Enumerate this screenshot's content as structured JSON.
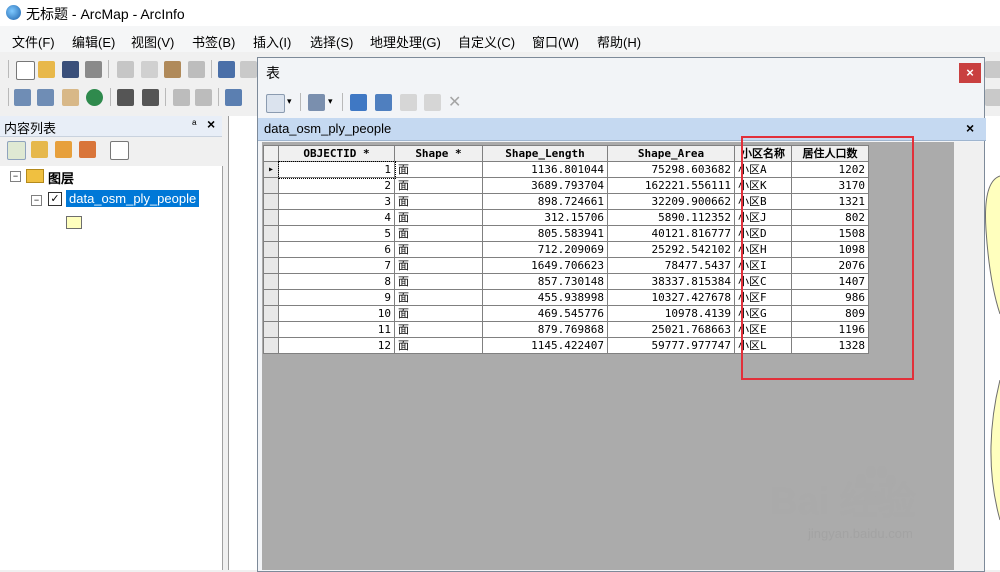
{
  "window": {
    "title": "无标题 - ArcMap - ArcInfo"
  },
  "menu": [
    "文件(F)",
    "编辑(E)",
    "视图(V)",
    "书签(B)",
    "插入(I)",
    "选择(S)",
    "地理处理(G)",
    "自定义(C)",
    "窗口(W)",
    "帮助(H)"
  ],
  "toc": {
    "title": "内容列表",
    "pin": "ᵃ",
    "close": "×",
    "layers_group": "图层",
    "layer_name": "data_osm_ply_people",
    "layer_checked": true
  },
  "table_window": {
    "title": "表",
    "close": "×",
    "tab_name": "data_osm_ply_people",
    "tab_close": "×",
    "columns": [
      "OBJECTID *",
      "Shape *",
      "Shape_Length",
      "Shape_Area",
      "小区名称",
      "居住人口数"
    ],
    "rows": [
      [
        "1",
        "面",
        "1136.801044",
        "75298.603682",
        "小区A",
        "1202"
      ],
      [
        "2",
        "面",
        "3689.793704",
        "162221.556111",
        "小区K",
        "3170"
      ],
      [
        "3",
        "面",
        "898.724661",
        "32209.900662",
        "小区B",
        "1321"
      ],
      [
        "4",
        "面",
        "312.15706",
        "5890.112352",
        "小区J",
        "802"
      ],
      [
        "5",
        "面",
        "805.583941",
        "40121.816777",
        "小区D",
        "1508"
      ],
      [
        "6",
        "面",
        "712.209069",
        "25292.542102",
        "小区H",
        "1098"
      ],
      [
        "7",
        "面",
        "1649.706623",
        "78477.5437",
        "小区I",
        "2076"
      ],
      [
        "8",
        "面",
        "857.730148",
        "38337.815384",
        "小区C",
        "1407"
      ],
      [
        "9",
        "面",
        "455.938998",
        "10327.427678",
        "小区F",
        "986"
      ],
      [
        "10",
        "面",
        "469.545776",
        "10978.4139",
        "小区G",
        "809"
      ],
      [
        "11",
        "面",
        "879.769868",
        "25021.768663",
        "小区E",
        "1196"
      ],
      [
        "12",
        "面",
        "1145.422407",
        "59777.977747",
        "小区L",
        "1328"
      ]
    ],
    "selected_row": 1
  },
  "watermark": {
    "brand": "Bai  经验",
    "url": "jingyan.baidu.com"
  },
  "colors": {
    "highlight": "#e2303a",
    "tab_strip": "#c5d9f1",
    "layer_selected": "#0078d7"
  }
}
